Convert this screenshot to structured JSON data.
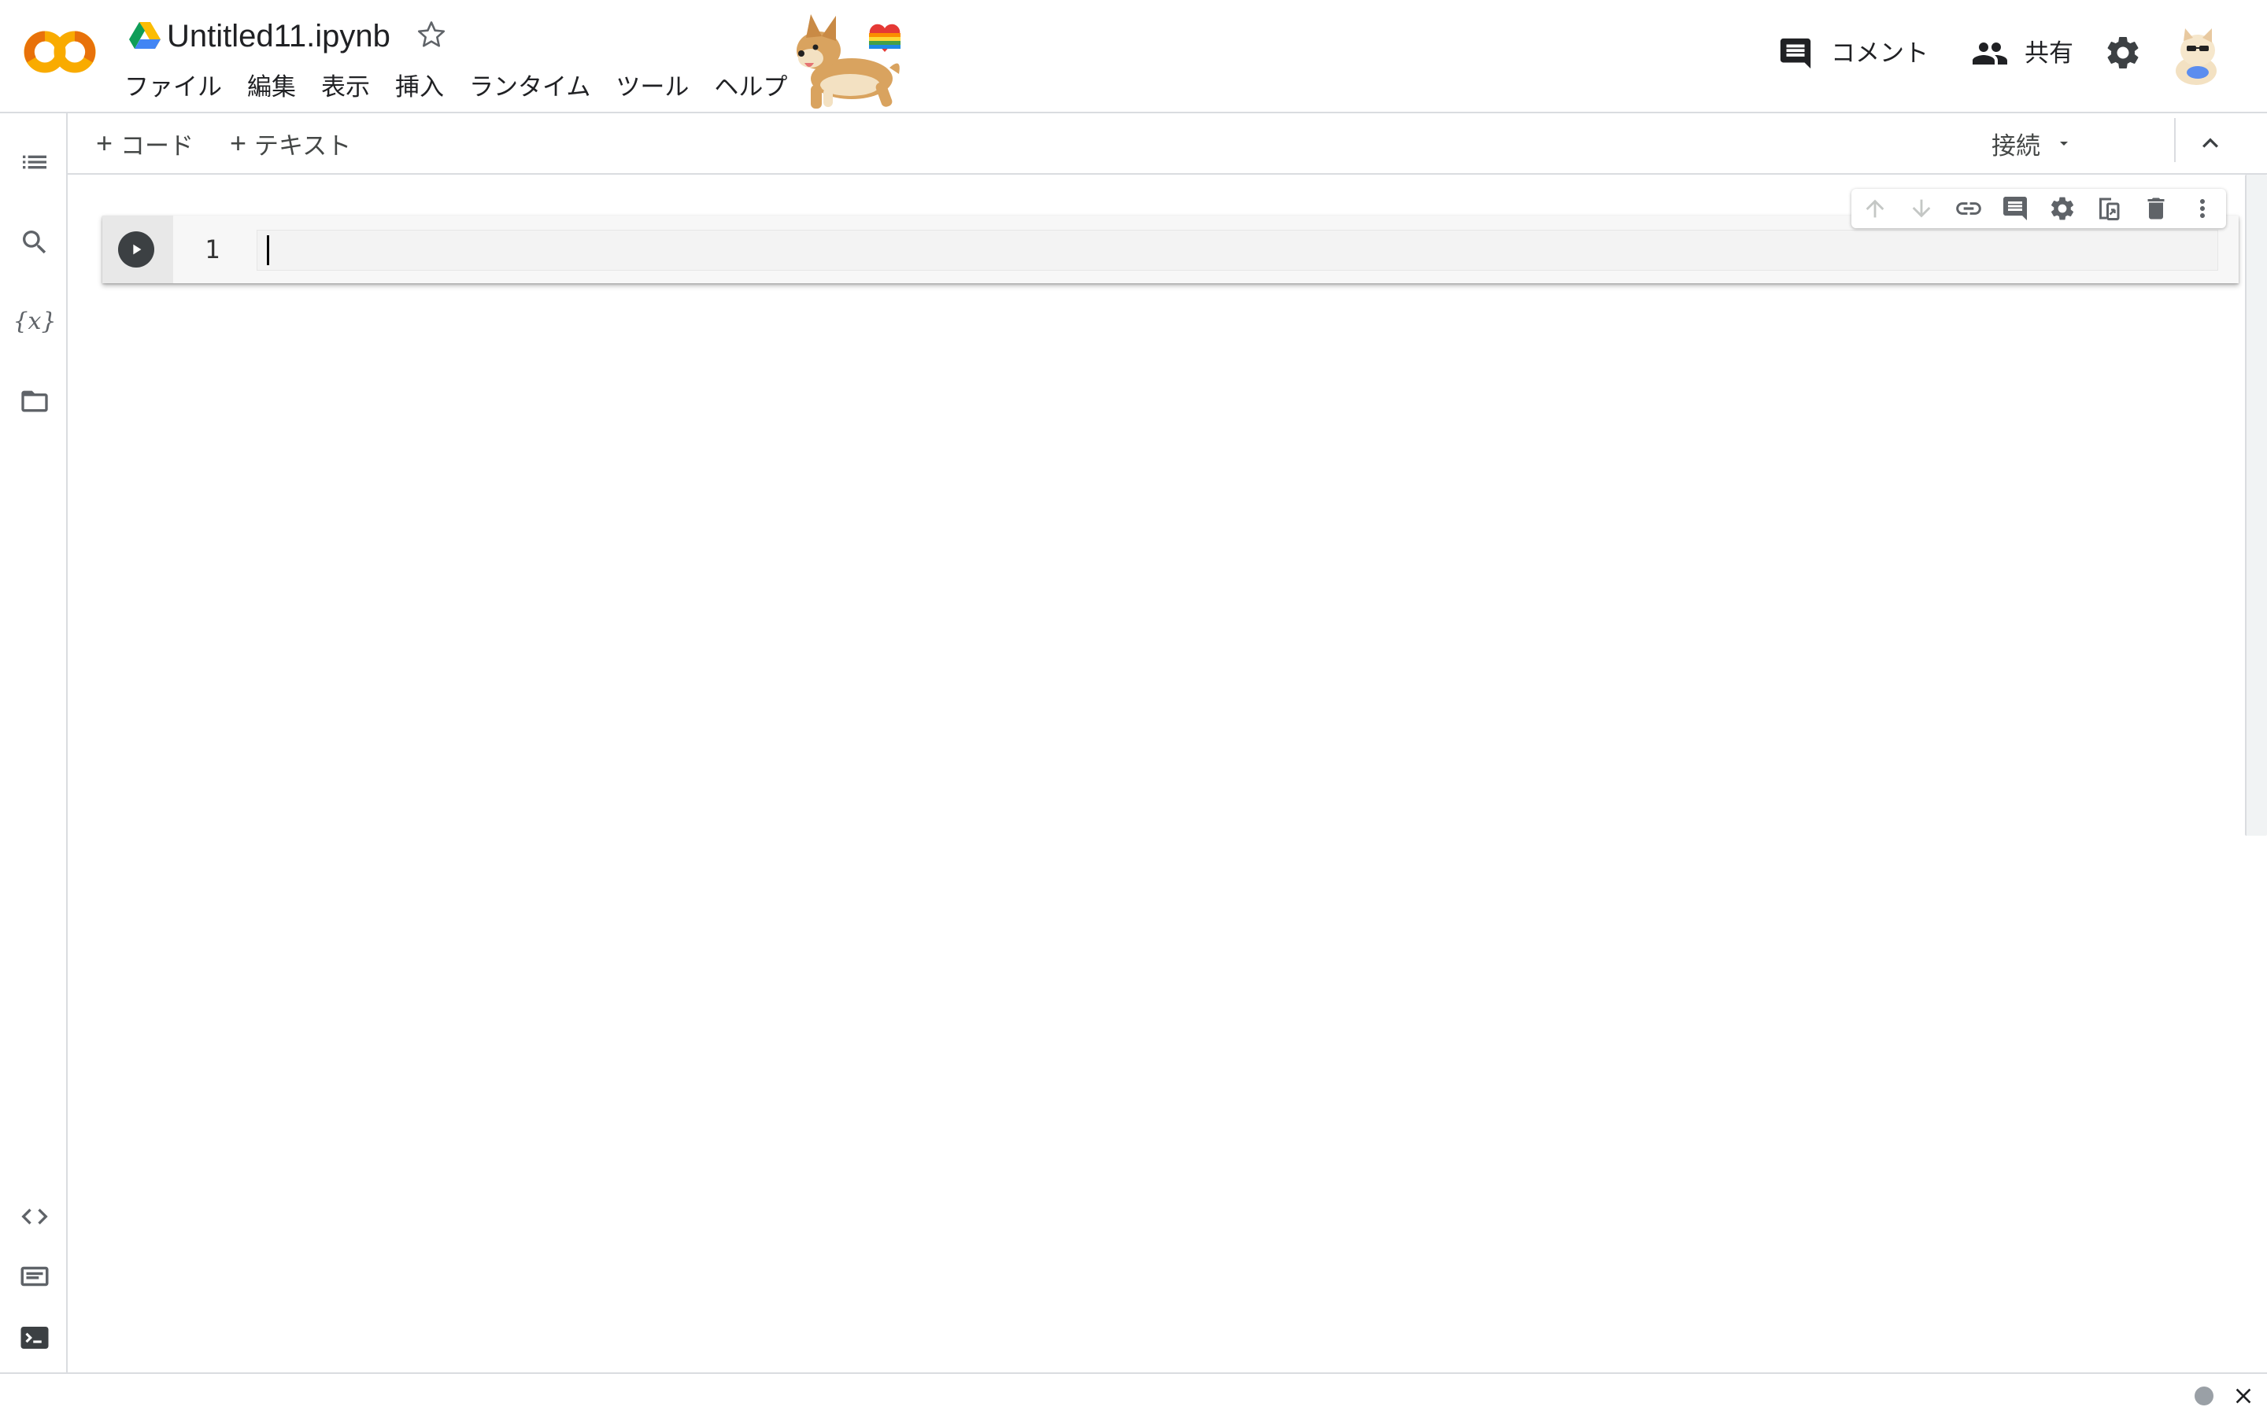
{
  "header": {
    "notebook_title": "Untitled11.ipynb",
    "menu": [
      {
        "label": "ファイル"
      },
      {
        "label": "編集"
      },
      {
        "label": "表示"
      },
      {
        "label": "挿入"
      },
      {
        "label": "ランタイム"
      },
      {
        "label": "ツール"
      },
      {
        "label": "ヘルプ"
      }
    ],
    "comment_label": "コメント",
    "share_label": "共有",
    "logo_icon": "colab-logo",
    "drive_icon": "google-drive-icon",
    "star_icon": "star-outline-icon",
    "mascot_icon": "corgi-mascot",
    "settings_icon": "gear-icon",
    "avatar_icon": "user-avatar"
  },
  "sidebar": {
    "top_items": [
      {
        "icon": "table-of-contents-icon"
      },
      {
        "icon": "search-icon"
      },
      {
        "icon": "variables-icon",
        "glyph": "{x}"
      },
      {
        "icon": "folder-icon"
      }
    ],
    "bottom_items": [
      {
        "icon": "code-snippets-icon"
      },
      {
        "icon": "command-palette-icon"
      },
      {
        "icon": "terminal-icon"
      }
    ]
  },
  "toolbar": {
    "add_code_label": "コード",
    "add_text_label": "テキスト",
    "connect_label": "接続",
    "plus_glyph": "+"
  },
  "cell": {
    "line_number": "1",
    "code": "",
    "toolbar_icons": [
      "move-up-icon",
      "move-down-icon",
      "link-icon",
      "comment-icon",
      "settings-icon",
      "mirror-cell-icon",
      "delete-icon",
      "more-vert-icon"
    ]
  },
  "colors": {
    "accent_orange": "#F9AB00",
    "accent_orange_dark": "#E8710A",
    "icon_gray": "#5f6368",
    "border": "#dadce0"
  }
}
